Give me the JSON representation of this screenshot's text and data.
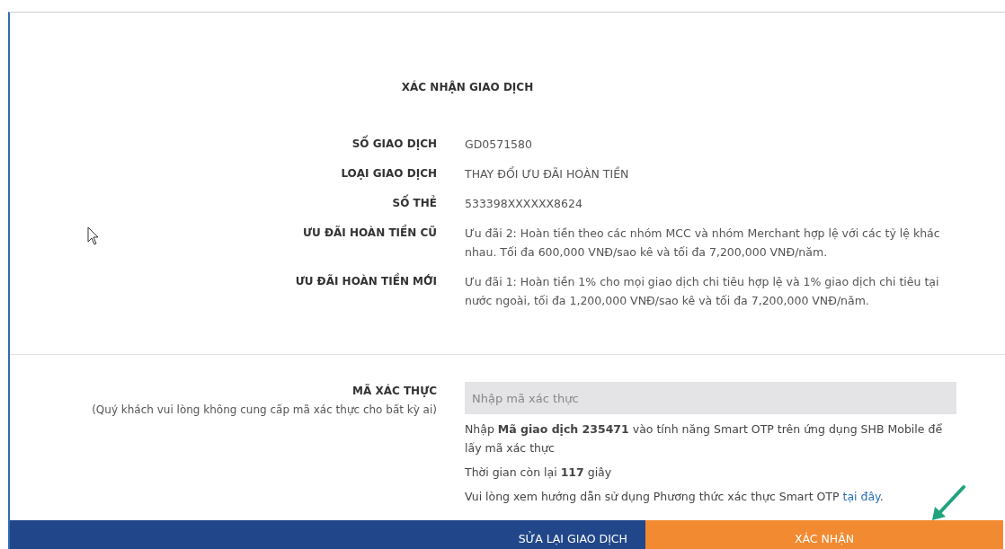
{
  "title": "XÁC NHẬN GIAO DỊCH",
  "details": [
    {
      "label": "SỐ GIAO DỊCH",
      "value": "GD0571580"
    },
    {
      "label": "LOẠI GIAO DỊCH",
      "value": "THAY ĐỔI ƯU ĐÃI HOÀN TIỀN"
    },
    {
      "label": "SỐ THẺ",
      "value": "533398XXXXXX8624"
    },
    {
      "label": "ƯU ĐÃI HOÀN TIỀN CŨ",
      "value": "Ưu đãi 2: Hoàn tiền theo các nhóm MCC và nhóm Merchant hợp lệ với các tỷ lệ khác nhau. Tối đa 600,000 VNĐ/sao kê và tối đa 7,200,000 VNĐ/năm."
    },
    {
      "label": "ƯU ĐÃI HOÀN TIỀN MỚI",
      "value": "Ưu đãi 1: Hoàn tiền 1% cho mọi giao dịch chi tiêu hợp lệ và 1% giao dịch chi tiêu tại nước ngoài, tối đa 1,200,000 VNĐ/sao kê và tối đa 7,200,000 VNĐ/năm."
    }
  ],
  "otp": {
    "label": "MÃ XÁC THỰC",
    "note": "(Quý khách vui lòng không cung cấp mã xác thực cho bất kỳ ai)",
    "placeholder": "Nhập mã xác thực",
    "instruction": "Nhập **Mã giao dịch 235471** vào tính năng Smart OTP trên ứng dụng SHB Mobile để lấy mã xác thực",
    "timer": "Thời gian còn lại **117** giây",
    "guide": {
      "text": "Vui lòng xem hướng dẫn sử dụng Phương thức xác thực Smart OTP ",
      "link": "tại đây",
      "suffix": "."
    }
  },
  "buttons": [
    {
      "label": "SỬA LẠI GIAO DỊCH",
      "kind": "secondary"
    },
    {
      "label": "XÁC NHẬN",
      "kind": "primary"
    }
  ]
}
